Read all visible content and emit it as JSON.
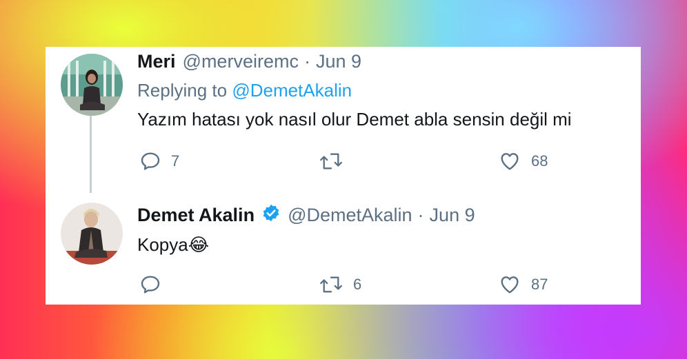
{
  "tweets": [
    {
      "name": "Meri",
      "handle": "@merveiremc",
      "dot": "·",
      "date": "Jun 9",
      "replying_prefix": "Replying to",
      "replying_mention": "@DemetAkalin",
      "text": "Yazım hatası yok nasıl olur Demet abla sensin değil mi",
      "replies": "7",
      "retweets": "",
      "likes": "68"
    },
    {
      "name": "Demet Akalin",
      "verified": true,
      "handle": "@DemetAkalin",
      "dot": "·",
      "date": "Jun 9",
      "text": "Kopya😂",
      "replies": "",
      "retweets": "6",
      "likes": "87"
    }
  ],
  "colors": {
    "link": "#1da1f2",
    "secondary_text": "#5b7083",
    "primary_text": "#14171a"
  },
  "icons": [
    "reply-icon",
    "retweet-icon",
    "like-icon",
    "verified-badge-icon"
  ]
}
